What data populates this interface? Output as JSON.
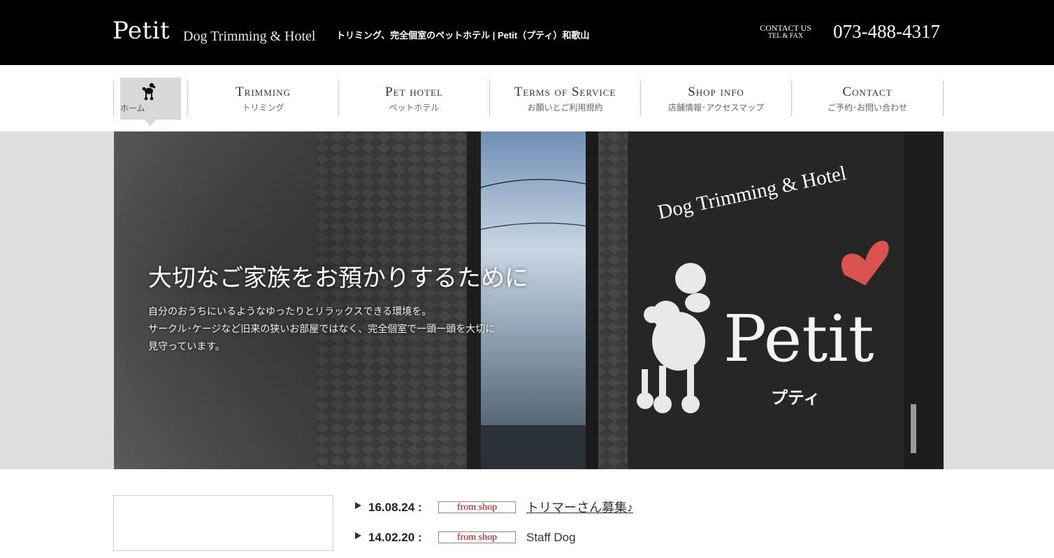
{
  "header": {
    "logo": "Petit",
    "logo_sub": "Dog Trimming & Hotel",
    "tagline": "トリミング、完全個室のペットホテル | Petit（プティ）和歌山",
    "contact_line1": "CONTACT US",
    "contact_line2": "TEL & FAX",
    "phone": "073-488-4317"
  },
  "nav": {
    "home_label": "ホーム",
    "items": [
      {
        "en": "Trimming",
        "ja": "トリミング"
      },
      {
        "en": "Pet hotel",
        "ja": "ペットホテル"
      },
      {
        "en": "Terms of Service",
        "ja": "お願いとご利用規約"
      },
      {
        "en": "Shop info",
        "ja": "店舗情報･アクセスマップ"
      },
      {
        "en": "Contact",
        "ja": "ご予約･お問い合わせ"
      }
    ]
  },
  "hero": {
    "title": "大切なご家族をお預かりするために",
    "body": [
      "自分のおうちにいるようなゆったりとリラックスできる環境を。",
      "サークル･ケージなど旧来の狭いお部屋ではなく、完全個室で一頭一頭を大切に",
      "見守っています。"
    ],
    "sign_sub": "Dog Trimming & Hotel",
    "sign_name": "Petit",
    "sign_kana": "プティ"
  },
  "news": [
    {
      "date": "16.08.24 :",
      "tag": "from shop",
      "text": "トリマーさん募集♪",
      "link": true
    },
    {
      "date": "14.02.20 :",
      "tag": "from shop",
      "text": "Staff Dog",
      "link": false
    }
  ],
  "colors": {
    "header_bg": "#000000",
    "nav_active_bg": "#d8d8d8",
    "nav_separator": "#7e9fbe",
    "tag_text": "#c00000",
    "heart": "#d9534f"
  }
}
